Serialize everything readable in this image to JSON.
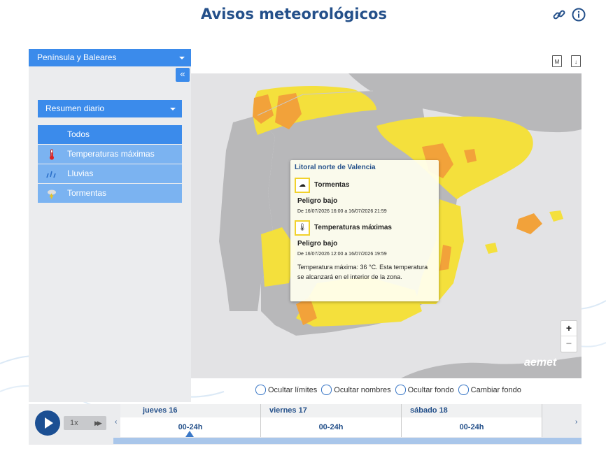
{
  "header": {
    "title": "Avisos meteorológicos",
    "link_icon": "link-icon",
    "info_icon": "info-icon"
  },
  "sidebar": {
    "region": "Península y Baleares",
    "collapse": "«",
    "mode": "Resumen diario",
    "items": [
      {
        "label": "Todos",
        "icon": "none",
        "active": true
      },
      {
        "label": "Temperaturas máximas",
        "icon": "thermometer-icon"
      },
      {
        "label": "Lluvias",
        "icon": "rain-icon"
      },
      {
        "label": "Tormentas",
        "icon": "storm-icon"
      }
    ]
  },
  "map_tools": [
    "M",
    "↓"
  ],
  "popup": {
    "title": "Litoral norte de Valencia",
    "warnings": [
      {
        "name": "Tormentas",
        "level": "Peligro bajo",
        "dates": "De 16/07/2026 16:00 a 16/07/2026 21:59"
      },
      {
        "name": "Temperaturas máximas",
        "level": "Peligro bajo",
        "dates": "De 16/07/2026 12:00 a 16/07/2026 19:59"
      }
    ],
    "description": "Temperatura máxima: 36 °C. Esta temperatura se alcanzará en el interior de la zona."
  },
  "zoom": {
    "in": "+",
    "out": "−"
  },
  "logo": "aemet",
  "options": [
    "Ocultar límites",
    "Ocultar nombres",
    "Ocultar fondo",
    "Cambiar fondo"
  ],
  "timeline": {
    "speed": "1x",
    "days": [
      {
        "label": "jueves 16",
        "slot": "00-24h"
      },
      {
        "label": "viernes 17",
        "slot": "00-24h"
      },
      {
        "label": "sábado 18",
        "slot": "00-24h"
      }
    ],
    "prev": "‹",
    "next": "›"
  },
  "colors": {
    "accent": "#3b8beb",
    "yellow": "#f4e03c",
    "orange": "#f2a23a",
    "title": "#24508a"
  }
}
